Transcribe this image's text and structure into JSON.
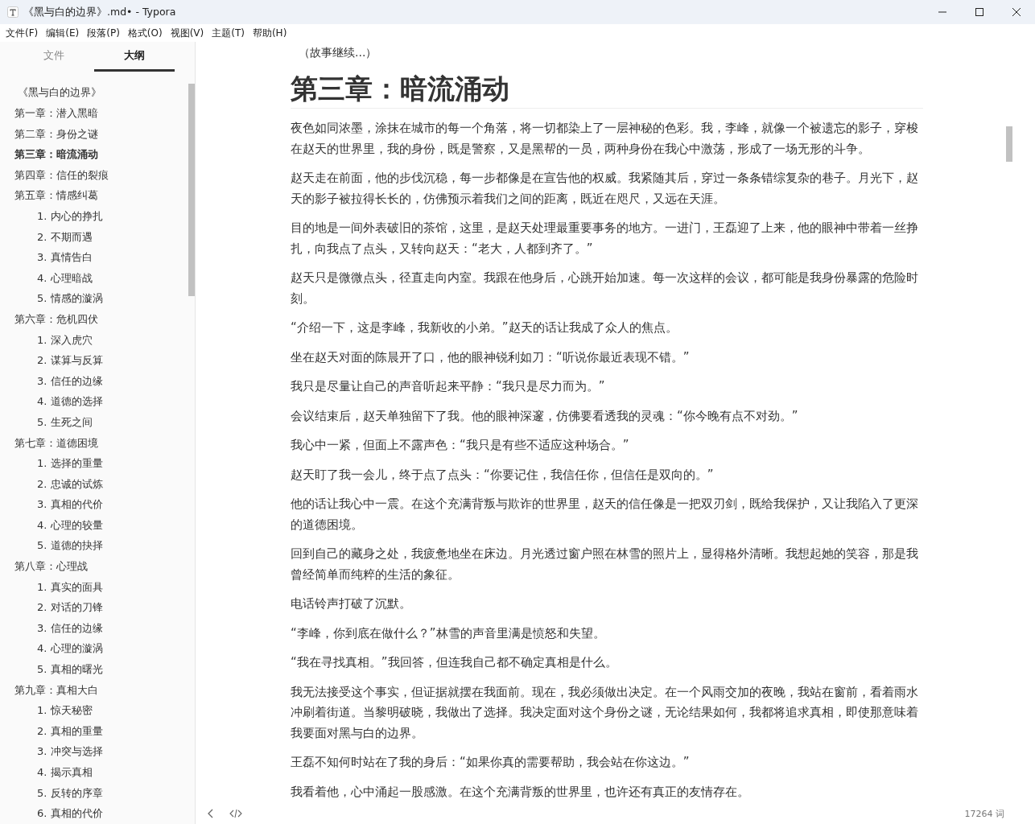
{
  "window": {
    "title": "《黑与白的边界》.md• - Typora"
  },
  "menu": [
    "文件(F)",
    "编辑(E)",
    "段落(P)",
    "格式(O)",
    "视图(V)",
    "主题(T)",
    "帮助(H)"
  ],
  "sidebar": {
    "tabs": [
      {
        "label": "文件",
        "selected": false
      },
      {
        "label": "大纲",
        "selected": true
      }
    ],
    "outline": [
      {
        "label": "《黑与白的边界》",
        "selected": false,
        "kind": "title"
      },
      {
        "label": "第一章：潜入黑暗",
        "selected": false
      },
      {
        "label": "第二章：身份之谜",
        "selected": false
      },
      {
        "label": "第三章：暗流涌动",
        "selected": true
      },
      {
        "label": "第四章：信任的裂痕",
        "selected": false
      },
      {
        "label": "第五章：情感纠葛",
        "selected": false,
        "children": [
          {
            "label": "1. 内心的挣扎",
            "selected": false
          },
          {
            "label": "2. 不期而遇",
            "selected": false
          },
          {
            "label": "3. 真情告白",
            "selected": false
          },
          {
            "label": "4. 心理暗战",
            "selected": false
          },
          {
            "label": "5. 情感的漩涡",
            "selected": false
          }
        ]
      },
      {
        "label": "第六章：危机四伏",
        "selected": false,
        "children": [
          {
            "label": "1. 深入虎穴",
            "selected": false
          },
          {
            "label": "2. 谋算与反算",
            "selected": false
          },
          {
            "label": "3. 信任的边缘",
            "selected": false
          },
          {
            "label": "4. 道德的选择",
            "selected": false
          },
          {
            "label": "5. 生死之间",
            "selected": false
          }
        ]
      },
      {
        "label": "第七章：道德困境",
        "selected": false,
        "children": [
          {
            "label": "1. 选择的重量",
            "selected": false
          },
          {
            "label": "2. 忠诚的试炼",
            "selected": false
          },
          {
            "label": "3. 真相的代价",
            "selected": false
          },
          {
            "label": "4. 心理的较量",
            "selected": false
          },
          {
            "label": "5. 道德的抉择",
            "selected": false
          }
        ]
      },
      {
        "label": "第八章：心理战",
        "selected": false,
        "children": [
          {
            "label": "1. 真实的面具",
            "selected": false
          },
          {
            "label": "2. 对话的刀锋",
            "selected": false
          },
          {
            "label": "3. 信任的边缘",
            "selected": false
          },
          {
            "label": "4. 心理的漩涡",
            "selected": false
          },
          {
            "label": "5. 真相的曙光",
            "selected": false
          }
        ]
      },
      {
        "label": "第九章：真相大白",
        "selected": false,
        "children": [
          {
            "label": "1. 惊天秘密",
            "selected": false
          },
          {
            "label": "2. 真相的重量",
            "selected": false
          },
          {
            "label": "3. 冲突与选择",
            "selected": false
          },
          {
            "label": "4. 揭示真相",
            "selected": false
          },
          {
            "label": "5. 反转的序章",
            "selected": false
          },
          {
            "label": "6. 真相的代价",
            "selected": false
          }
        ]
      }
    ]
  },
  "document": {
    "lead": "（故事继续...）",
    "heading": "第三章：暗流涌动",
    "paragraphs": [
      "夜色如同浓墨，涂抹在城市的每一个角落，将一切都染上了一层神秘的色彩。我，李峰，就像一个被遗忘的影子，穿梭在赵天的世界里，我的身份，既是警察，又是黑帮的一员，两种身份在我心中激荡，形成了一场无形的斗争。",
      "赵天走在前面，他的步伐沉稳，每一步都像是在宣告他的权威。我紧随其后，穿过一条条错综复杂的巷子。月光下，赵天的影子被拉得长长的，仿佛预示着我们之间的距离，既近在咫尺，又远在天涯。",
      "目的地是一间外表破旧的茶馆，这里，是赵天处理最重要事务的地方。一进门，王磊迎了上来，他的眼神中带着一丝挣扎，向我点了点头，又转向赵天：“老大，人都到齐了。”",
      "赵天只是微微点头，径直走向内室。我跟在他身后，心跳开始加速。每一次这样的会议，都可能是我身份暴露的危险时刻。",
      "“介绍一下，这是李峰，我新收的小弟。”赵天的话让我成了众人的焦点。",
      "坐在赵天对面的陈晨开了口，他的眼神锐利如刀：“听说你最近表现不错。”",
      "我只是尽量让自己的声音听起来平静：“我只是尽力而为。”",
      "会议结束后，赵天单独留下了我。他的眼神深邃，仿佛要看透我的灵魂：“你今晚有点不对劲。”",
      "我心中一紧，但面上不露声色：“我只是有些不适应这种场合。”",
      "赵天盯了我一会儿，终于点了点头：“你要记住，我信任你，但信任是双向的。”",
      "他的话让我心中一震。在这个充满背叛与欺诈的世界里，赵天的信任像是一把双刃剑，既给我保护，又让我陷入了更深的道德困境。",
      "回到自己的藏身之处，我疲惫地坐在床边。月光透过窗户照在林雪的照片上，显得格外清晰。我想起她的笑容，那是我曾经简单而纯粹的生活的象征。",
      "电话铃声打破了沉默。",
      "“李峰，你到底在做什么？”林雪的声音里满是愤怒和失望。",
      "“我在寻找真相。”我回答，但连我自己都不确定真相是什么。",
      "我无法接受这个事实，但证据就摆在我面前。现在，我必须做出决定。在一个风雨交加的夜晚，我站在窗前，看着雨水冲刷着街道。当黎明破晓，我做出了选择。我决定面对这个身份之谜，无论结果如何，我都将追求真相，即使那意味着我要面对黑与白的边界。",
      "王磊不知何时站在了我的身后：“如果你真的需要帮助，我会站在你这边。”",
      "我看着他，心中涌起一股感激。在这个充满背叛的世界里，也许还有真正的友情存在。"
    ]
  },
  "status": {
    "word_count": "17264 词"
  }
}
